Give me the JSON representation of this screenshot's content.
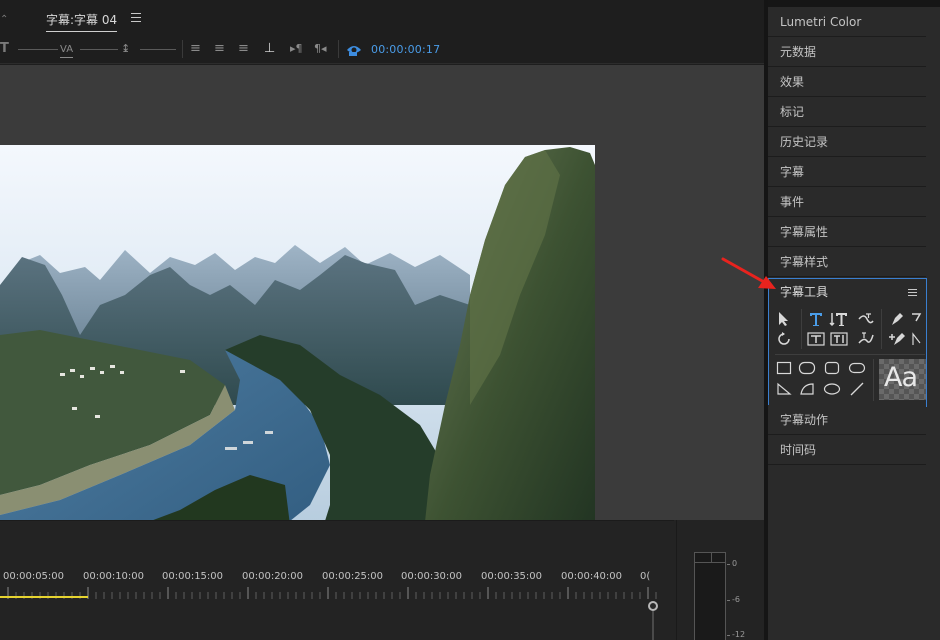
{
  "tab": {
    "left_fragment": "⌃",
    "title": "字幕:字幕 04"
  },
  "toolbar": {
    "timecode": "00:00:00:17",
    "icons": [
      "font-size-icon",
      "kerning-icon",
      "leading-icon",
      "align-left-icon",
      "align-center-icon",
      "align-right-icon",
      "tab-stops-icon",
      "paragraph-left-icon",
      "paragraph-right-icon",
      "show-background-video-icon"
    ]
  },
  "right_panel": {
    "items_before": [
      {
        "label": "Lumetri Color",
        "name": "panel-item-lumetri-color"
      },
      {
        "label": "元数据",
        "name": "panel-item-metadata"
      },
      {
        "label": "效果",
        "name": "panel-item-effects"
      },
      {
        "label": "标记",
        "name": "panel-item-markers"
      },
      {
        "label": "历史记录",
        "name": "panel-item-history"
      },
      {
        "label": "字幕",
        "name": "panel-item-captions"
      },
      {
        "label": "事件",
        "name": "panel-item-events"
      },
      {
        "label": "字幕属性",
        "name": "panel-item-title-properties"
      },
      {
        "label": "字幕样式",
        "name": "panel-item-title-styles"
      }
    ],
    "tools_panel": {
      "title": "字幕工具",
      "style_preview_text": "Aa"
    },
    "items_after": [
      {
        "label": "字幕动作",
        "name": "panel-item-title-actions"
      },
      {
        "label": "时间码",
        "name": "panel-item-timecode"
      }
    ]
  },
  "timeline": {
    "timecodes": [
      "00:00:05:00",
      "00:00:10:00",
      "00:00:15:00",
      "00:00:20:00",
      "00:00:25:00",
      "00:00:30:00",
      "00:00:35:00",
      "00:00:40:00",
      "0("
    ]
  },
  "audio_meter": {
    "labels": [
      "0",
      "-6",
      "-12"
    ]
  },
  "colors": {
    "accent_blue": "#4a9ce8",
    "selection_border": "#3a7fd0",
    "playhead_yellow": "#e6d430",
    "annotation_arrow": "#e8231e"
  }
}
